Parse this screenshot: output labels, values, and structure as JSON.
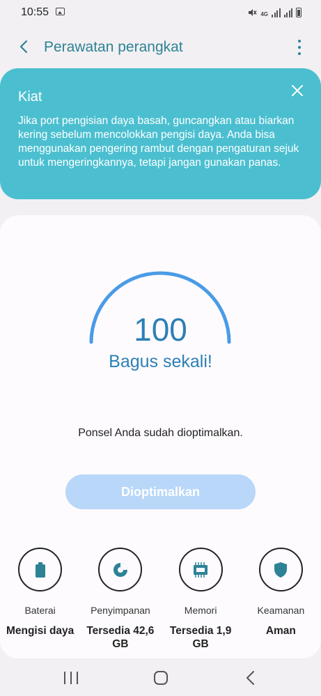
{
  "status_bar": {
    "time": "10:55",
    "network": "4G"
  },
  "app_bar": {
    "title": "Perawatan perangkat"
  },
  "tip": {
    "title": "Kiat",
    "body": "Jika port pengisian daya basah, guncangkan atau biarkan kering sebelum mencolokkan pengisi daya. Anda bisa menggunakan pengering rambut dengan pengaturan sejuk untuk mengeringkannya, tetapi jangan gunakan panas."
  },
  "score": {
    "value": "100",
    "status": "Bagus sekali!",
    "description": "Ponsel Anda sudah dioptimalkan."
  },
  "optimize_button": {
    "label": "Dioptimalkan"
  },
  "features": [
    {
      "icon": "battery-icon",
      "label": "Baterai",
      "value": "Mengisi daya"
    },
    {
      "icon": "storage-pie-icon",
      "label": "Penyimpanan",
      "value": "Tersedia 42,6 GB"
    },
    {
      "icon": "memory-chip-icon",
      "label": "Memori",
      "value": "Tersedia 1,9 GB"
    },
    {
      "icon": "shield-icon",
      "label": "Keamanan",
      "value": "Aman"
    }
  ],
  "colors": {
    "accent": "#2d8296",
    "score_blue": "#2d7fb6",
    "tip_background": "#4bbfd0",
    "button_disabled": "#b8d7f9",
    "gauge_arc": "#4a9be6"
  }
}
